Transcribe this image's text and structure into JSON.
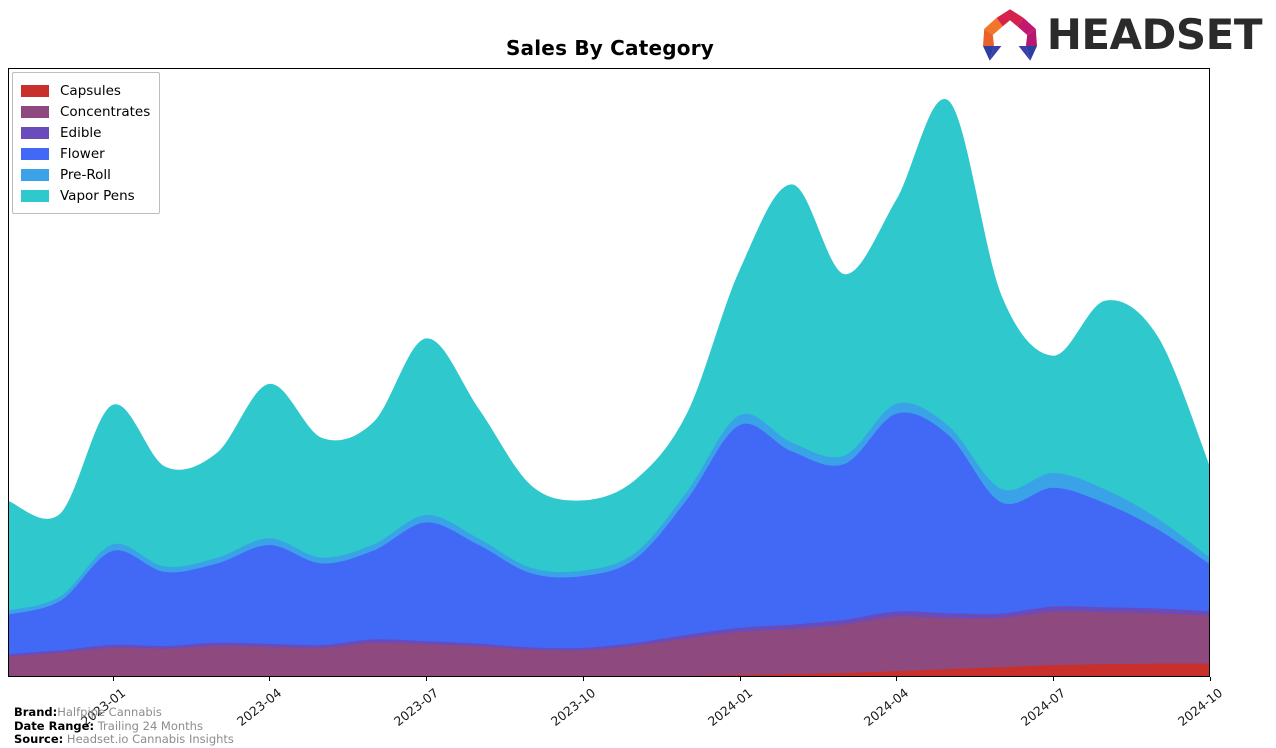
{
  "header": {
    "title": "Sales By Category",
    "logo_text": "HEADSET",
    "logo_colors": {
      "top_red": "#d6224a",
      "magenta": "#c2186f",
      "orange": "#f2752b",
      "blue": "#2b3fa0",
      "indigo": "#3b3fa8"
    }
  },
  "legend": {
    "position": "upper-left",
    "items": [
      {
        "label": "Capsules",
        "color": "#c9302c"
      },
      {
        "label": "Concentrates",
        "color": "#8e4a7e"
      },
      {
        "label": "Edible",
        "color": "#6a4bbc"
      },
      {
        "label": "Flower",
        "color": "#4169f5"
      },
      {
        "label": "Pre-Roll",
        "color": "#3aa3e8"
      },
      {
        "label": "Vapor Pens",
        "color": "#2ec8cd"
      }
    ]
  },
  "footer": {
    "rows": [
      {
        "key": "Brand:",
        "value": "Halfpipe Cannabis"
      },
      {
        "key": "Date Range:",
        "value": "Trailing 24 Months"
      },
      {
        "key": "Source:",
        "value": "Headset.io Cannabis Insights"
      }
    ]
  },
  "chart_data": {
    "type": "area",
    "stacked": true,
    "title": "Sales By Category",
    "xlabel": "",
    "ylabel": "",
    "grid": false,
    "legend_position": "upper left",
    "x_tick_labels": [
      "2023-01",
      "2023-04",
      "2023-07",
      "2023-10",
      "2024-01",
      "2024-04",
      "2024-07",
      "2024-10"
    ],
    "x_tick_rotation": -38,
    "y_axis_visible": false,
    "x": [
      "2022-11",
      "2022-12",
      "2023-01",
      "2023-02",
      "2023-03",
      "2023-04",
      "2023-05",
      "2023-06",
      "2023-07",
      "2023-08",
      "2023-09",
      "2023-10",
      "2023-11",
      "2023-12",
      "2024-01",
      "2024-02",
      "2024-03",
      "2024-04",
      "2024-05",
      "2024-06",
      "2024-07",
      "2024-08",
      "2024-09",
      "2024-10"
    ],
    "series": [
      {
        "name": "Capsules",
        "color": "#c9302c",
        "values": [
          0,
          0,
          0,
          0,
          0,
          0,
          0,
          0,
          0,
          0,
          0,
          0,
          0.2,
          0.6,
          1.0,
          1.4,
          1.8,
          2.6,
          3.4,
          4.2,
          5.0,
          5.4,
          5.6,
          5.6
        ]
      },
      {
        "name": "Concentrates",
        "color": "#8e4a7e",
        "values": [
          8.5,
          10.0,
          12.0,
          11.6,
          12.8,
          12.4,
          12.0,
          14.0,
          13.4,
          12.6,
          11.2,
          11.0,
          12.6,
          15.2,
          17.4,
          18.2,
          19.6,
          22.0,
          20.6,
          19.8,
          21.6,
          21.0,
          20.4,
          19.4
        ]
      },
      {
        "name": "Edible",
        "color": "#6a4bbc",
        "values": [
          0.9,
          1.0,
          1.2,
          1.1,
          1.3,
          1.2,
          1.1,
          1.4,
          1.3,
          1.1,
          1.0,
          1.0,
          1.2,
          1.5,
          1.7,
          1.8,
          1.9,
          2.1,
          2.0,
          1.9,
          2.1,
          2.0,
          1.9,
          1.8
        ]
      },
      {
        "name": "Flower",
        "color": "#4169f5",
        "values": [
          16.0,
          20.0,
          38.0,
          30.0,
          32.0,
          40.0,
          33.0,
          36.0,
          48.0,
          40.0,
          30.0,
          29.0,
          34.0,
          55.0,
          82.0,
          70.0,
          63.0,
          80.0,
          72.0,
          45.0,
          48.0,
          42.0,
          32.0,
          19.0
        ]
      },
      {
        "name": "Pre-Roll",
        "color": "#3aa3e8",
        "values": [
          1.6,
          1.8,
          2.6,
          2.2,
          2.3,
          2.7,
          2.4,
          2.5,
          3.0,
          2.6,
          2.2,
          2.2,
          2.4,
          3.2,
          4.0,
          3.6,
          3.4,
          4.0,
          3.7,
          5.4,
          6.0,
          5.6,
          4.4,
          2.6
        ]
      },
      {
        "name": "Vapor Pens",
        "color": "#2ec8cd",
        "values": [
          44.0,
          33.0,
          56.0,
          40.0,
          42.0,
          62.0,
          48.0,
          49.0,
          71.0,
          52.0,
          33.0,
          28.0,
          29.0,
          31.0,
          58.0,
          104.0,
          73.0,
          82.0,
          131.0,
          78.0,
          47.0,
          76.0,
          73.0,
          36.0
        ]
      }
    ]
  }
}
